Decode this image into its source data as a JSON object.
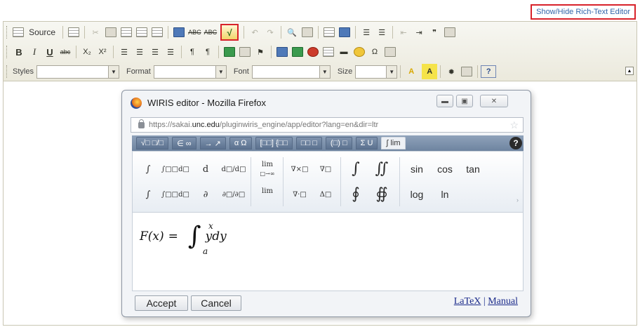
{
  "top_link": "Show/Hide Rich-Text Editor",
  "toolbar": {
    "source_label": "Source",
    "row1_glyphs": [
      "ABC",
      "ABC",
      "√"
    ],
    "row2": {
      "bold": "B",
      "italic": "I",
      "underline": "U",
      "strike": "abc",
      "subscript": "X₂",
      "superscript": "X²",
      "omega": "Ω"
    },
    "styles_label": "Styles",
    "format_label": "Format",
    "font_label": "Font",
    "size_label": "Size",
    "text_color": "A",
    "bg_color": "A",
    "help": "?"
  },
  "popup": {
    "title": "WIRIS editor - Mozilla Firefox",
    "url_prefix": "https://sakai.",
    "url_host": "unc.edu",
    "url_suffix": "/pluginwiris_engine/app/editor?lang=en&dir=ltr",
    "tabs": [
      "√□ □/□",
      "∈ ∞",
      "→ ↗",
      "α Ω",
      "[□□] {□□",
      "□□ □",
      "(□) □",
      "Σ U",
      "∫ lim"
    ],
    "help": "?",
    "palette": {
      "d": "d",
      "dd": "d□/d□",
      "lim": "lim",
      "lim_sub": "□→∞",
      "lim2": "lim",
      "cross": "∇×□",
      "grad": "∇□",
      "dot": "∇·□",
      "lap": "Δ□",
      "partial": "∂",
      "pd": "∂□/∂□",
      "int": "∫",
      "iint": "∬",
      "oint": "∮",
      "oiint": "∯",
      "sin": "sin",
      "cos": "cos",
      "tan": "tan",
      "log": "log",
      "ln": "ln",
      "intdef1": "∫□□d□",
      "intdef2": "∫□□d□",
      "intsub1": "∫",
      "intsub2": "∫"
    },
    "formula": {
      "lhs": "F(x)",
      "eq": "=",
      "integrand": "ydy",
      "upper": "x",
      "lower": "a"
    },
    "accept": "Accept",
    "cancel": "Cancel",
    "latex": "LaTeX",
    "sep": "|",
    "manual": "Manual"
  }
}
